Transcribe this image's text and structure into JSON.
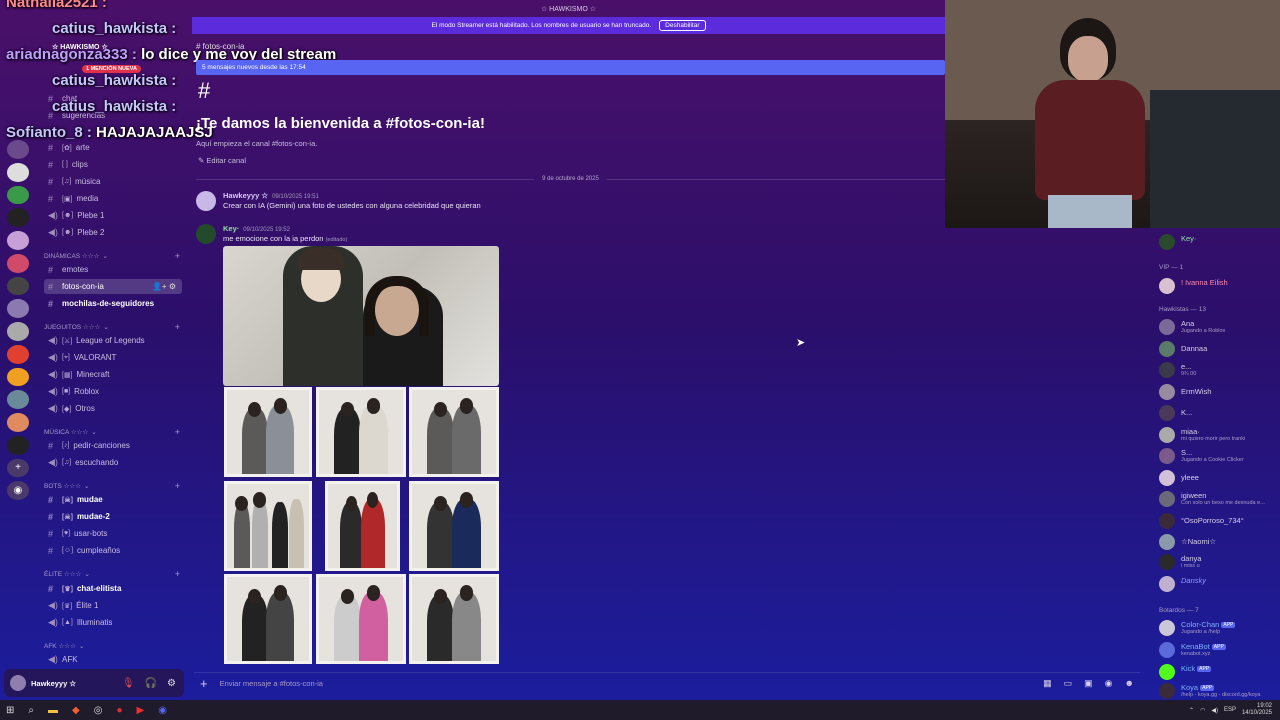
{
  "window": {
    "title": "☆ HAWKISMO ☆"
  },
  "streamer_bar": {
    "text": "El modo Streamer está habilitado. Los nombres de usuario se han truncado.",
    "button": "Deshabilitar"
  },
  "server": {
    "name": "☆ HAWKISMO ☆",
    "mention_badge": "1 MENCIÓN NUEVA"
  },
  "chat_overlay": [
    {
      "user": "Nathalia2521 :",
      "text": ""
    },
    {
      "user": "catius_hawkista :",
      "text": ""
    },
    {
      "user": "ariadnagonza333 :",
      "text": "lo dice y me voy del stream"
    },
    {
      "user": "catius_hawkista :",
      "text": ""
    },
    {
      "user": "catius_hawkista :",
      "text": ""
    },
    {
      "user": "Sofianto_8 :",
      "text": "HAJAJAJAAJSJ"
    }
  ],
  "sidebar": {
    "top_channels": [
      {
        "label": "chat"
      },
      {
        "label": "sugerencias"
      },
      {
        "label": "arte"
      },
      {
        "label": "clips"
      },
      {
        "label": "música"
      },
      {
        "label": "media"
      },
      {
        "label": "Plebe 1"
      },
      {
        "label": "Plebe 2"
      }
    ],
    "cat_dinamicas": "DINÁMICAS ☆☆☆",
    "dinamicas": [
      {
        "label": "emotes"
      },
      {
        "label": "fotos-con-ia"
      },
      {
        "label": "mochilas-de-seguidores"
      }
    ],
    "cat_juegos": "JUEGUITOS ☆☆☆",
    "juegos": [
      {
        "label": "League of Legends"
      },
      {
        "label": "VALORANT"
      },
      {
        "label": "Minecraft"
      },
      {
        "label": "Roblox"
      },
      {
        "label": "Otros"
      }
    ],
    "cat_musica": "MÚSICA ☆☆☆",
    "musica": [
      {
        "label": "pedir-canciones"
      },
      {
        "label": "escuchando"
      }
    ],
    "cat_bots": "BOTS ☆☆☆",
    "bots": [
      {
        "label": "mudae"
      },
      {
        "label": "mudae-2"
      },
      {
        "label": "usar-bots"
      },
      {
        "label": "cumpleaños"
      }
    ],
    "cat_elite": "ÉLITE ☆☆☆",
    "elite": [
      {
        "label": "chat-elitista"
      },
      {
        "label": "Élite 1"
      },
      {
        "label": "Illuminatis"
      }
    ],
    "cat_afk": "AFK ☆☆☆",
    "afk": [
      {
        "label": "AFK"
      }
    ]
  },
  "user_panel": {
    "name": "Hawkeyyy ☆"
  },
  "main": {
    "channel": "fotos-con-ia",
    "new_messages": "5 mensajes nuevos desde las 17:54",
    "welcome_title": "¡Te damos la bienvenida a #fotos-con-ia!",
    "welcome_sub": "Aquí empieza el canal #fotos-con-ia.",
    "edit_channel": "Editar canal",
    "date_divider": "9 de octubre de 2025",
    "messages": [
      {
        "name": "Hawkeyyy ☆",
        "time": "09/10/2025 19:51",
        "text": "Crear con IA (Gemini) una foto de ustedes con alguna celebridad que quieran"
      },
      {
        "name": "Key·",
        "time": "09/10/2025 19:52",
        "text": "me emocione con la ia perdon",
        "edited": "(editado)"
      }
    ],
    "composer_placeholder": "Enviar mensaje a #fotos-con-ia"
  },
  "members": {
    "top": {
      "name": "Key·"
    },
    "vip_header": "VIP — 1",
    "vip": [
      {
        "name": "! Ivanna Eilish",
        "status": ""
      }
    ],
    "hawkistas_header": "Hawkistas — 13",
    "hawkistas": [
      {
        "name": "Ana",
        "status": "Jugando a Roblox"
      },
      {
        "name": "Dannaa",
        "status": ""
      },
      {
        "name": "e...",
        "status": "9¾ 00"
      },
      {
        "name": "ErmWish",
        "status": ""
      },
      {
        "name": "K...",
        "status": ""
      },
      {
        "name": "miaa·",
        "status": "mi quiero morir pero tranki"
      },
      {
        "name": "S...",
        "status": "Jugando a Cookie Clicker"
      },
      {
        "name": "yleee",
        "status": ""
      },
      {
        "name": "igiween",
        "status": "Con solo un beso me desnuda e..."
      },
      {
        "name": "°OsoPorroso_734°",
        "status": ""
      },
      {
        "name": "☆Naomi☆",
        "status": ""
      },
      {
        "name": "danya",
        "status": "i miss u"
      },
      {
        "name": "Dansky",
        "status": ""
      }
    ],
    "botardos_header": "Botardos — 7",
    "botardos": [
      {
        "name": "Color-Chan",
        "status": "Jugando a /help"
      },
      {
        "name": "KenaBot",
        "status": "kenabot.xyz"
      },
      {
        "name": "Kick",
        "status": ""
      },
      {
        "name": "Koya",
        "status": "/help - koya.gg - discord.gg/koya"
      }
    ],
    "app_tag": "APP"
  },
  "taskbar": {
    "lang": "ESP",
    "time": "19:02",
    "date": "14/10/2025"
  }
}
